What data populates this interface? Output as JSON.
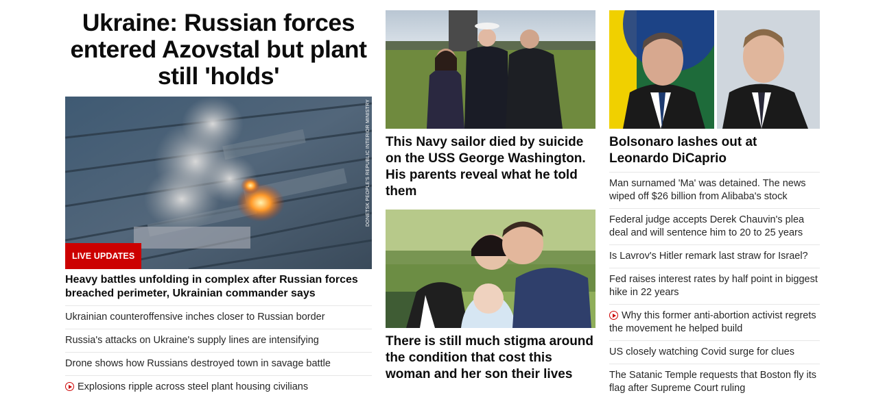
{
  "lead": {
    "headline": "Ukraine: Russian forces entered Azovstal but plant still 'holds'",
    "badge": "LIVE UPDATES",
    "image_credit": "DONETSK PEOPLE'S REPUBLIC INTERIOR MINISTRY",
    "sub_headline": "Heavy battles unfolding in complex after Russian forces breached perimeter, Ukrainian commander says",
    "links": [
      {
        "text": "Ukrainian counteroffensive inches closer to Russian border",
        "video": false
      },
      {
        "text": "Russia's attacks on Ukraine's supply lines are intensifying",
        "video": false
      },
      {
        "text": "Drone shows how Russians destroyed town in savage battle",
        "video": false
      },
      {
        "text": "Explosions ripple across steel plant housing civilians",
        "video": true,
        "icon": "play-icon"
      }
    ]
  },
  "middle": {
    "story1": {
      "headline": "This Navy sailor died by suicide on the USS George Washington. His parents reveal what he told them"
    },
    "story2": {
      "headline": "There is still much stigma around the condition that cost this woman and her son their lives"
    }
  },
  "right": {
    "headline": "Bolsonaro lashes out at Leonardo DiCaprio",
    "links": [
      {
        "text": "Man surnamed 'Ma' was detained. The news wiped off $26 billion from Alibaba's stock",
        "video": false
      },
      {
        "text": "Federal judge accepts Derek Chauvin's plea deal and will sentence him to 20 to 25 years",
        "video": false
      },
      {
        "text": "Is Lavrov's Hitler remark last straw for Israel?",
        "video": false
      },
      {
        "text": "Fed raises interest rates by half point in biggest hike in 22 years",
        "video": false
      },
      {
        "text": "Why this former anti-abortion activist regrets the movement he helped build",
        "video": true,
        "icon": "play-icon"
      },
      {
        "text": "US closely watching Covid surge for clues",
        "video": false
      },
      {
        "text": "The Satanic Temple requests that Boston fly its flag after Supreme Court ruling",
        "video": false
      }
    ]
  },
  "colors": {
    "accent_red": "#cc0000",
    "text": "#0c0c0c",
    "link": "#262626",
    "divider": "#e6e6e6"
  }
}
